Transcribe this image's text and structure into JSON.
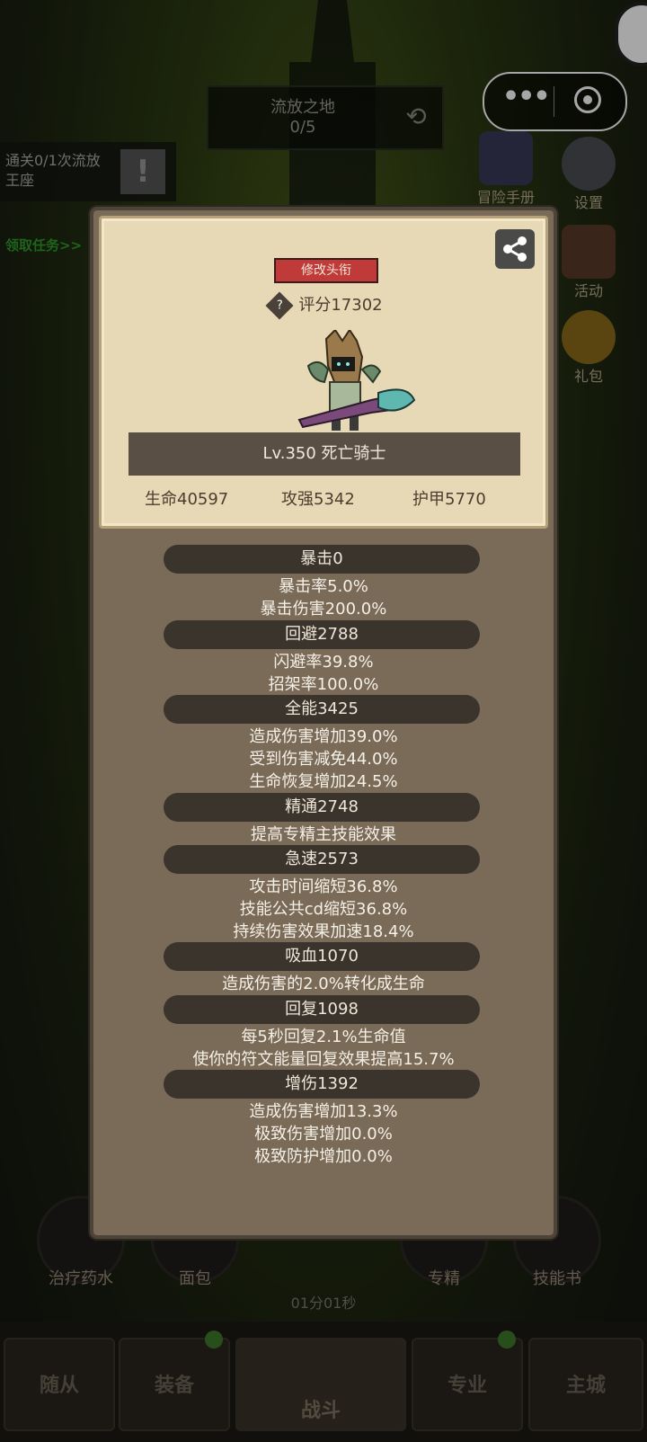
{
  "top": {
    "stage_name": "流放之地",
    "stage_progress": "0/5",
    "quest_text": "通关0/1次流放王座",
    "quest_link": "领取任务>>"
  },
  "right_menu": [
    {
      "label": "冒险手册",
      "icon": "book-icon"
    },
    {
      "label": "设置",
      "icon": "gear-icon"
    },
    {
      "label": "活动",
      "icon": "scroll-icon"
    },
    {
      "label": "礼包",
      "icon": "giftpack-icon"
    }
  ],
  "card": {
    "rename_label": "修改头衔",
    "score": "评分17302",
    "character": "Lv.350 死亡骑士",
    "hp": "生命40597",
    "atk": "攻强5342",
    "armor": "护甲5770"
  },
  "attributes": [
    {
      "head": "暴击0",
      "lines": [
        "暴击率5.0%",
        "暴击伤害200.0%"
      ]
    },
    {
      "head": "回避2788",
      "lines": [
        "闪避率39.8%",
        "招架率100.0%"
      ]
    },
    {
      "head": "全能3425",
      "lines": [
        "造成伤害增加39.0%",
        "受到伤害减免44.0%",
        "生命恢复增加24.5%"
      ]
    },
    {
      "head": "精通2748",
      "lines": [
        "提高专精主技能效果"
      ]
    },
    {
      "head": "急速2573",
      "lines": [
        "攻击时间缩短36.8%",
        "技能公共cd缩短36.8%",
        "持续伤害效果加速18.4%"
      ]
    },
    {
      "head": "吸血1070",
      "lines": [
        "造成伤害的2.0%转化成生命"
      ]
    },
    {
      "head": "回复1098",
      "lines": [
        "每5秒回复2.1%生命值",
        "使你的符文能量回复效果提高15.7%"
      ]
    },
    {
      "head": "增伤1392",
      "lines": [
        "造成伤害增加13.3%",
        "极致伤害增加0.0%",
        "极致防护增加0.0%"
      ]
    }
  ],
  "bottom": {
    "skills": [
      "治疗药水",
      "面包",
      "专精",
      "技能书"
    ],
    "timer": "01分01秒",
    "tabs": [
      "随从",
      "装备",
      "战斗",
      "专业",
      "主城"
    ]
  },
  "colors": {
    "rename_button": "#c03a3a",
    "panel_bg": "#7a6a58",
    "card_bg": "#e8d9b6",
    "attr_header": "#3a342d"
  }
}
